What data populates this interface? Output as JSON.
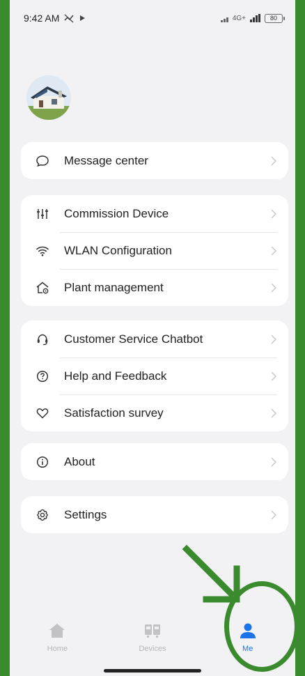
{
  "status_bar": {
    "time": "9:42 AM",
    "network": "4G+",
    "battery": "80"
  },
  "menu": {
    "group1": [
      {
        "label": "Message center",
        "icon": "message-icon"
      }
    ],
    "group2": [
      {
        "label": "Commission Device",
        "icon": "sliders-icon"
      },
      {
        "label": "WLAN Configuration",
        "icon": "wifi-icon"
      },
      {
        "label": "Plant management",
        "icon": "plant-house-icon"
      }
    ],
    "group3": [
      {
        "label": "Customer Service Chatbot",
        "icon": "headset-icon"
      },
      {
        "label": "Help and Feedback",
        "icon": "help-icon"
      },
      {
        "label": "Satisfaction survey",
        "icon": "heart-icon"
      }
    ],
    "group4": [
      {
        "label": "About",
        "icon": "info-icon"
      }
    ],
    "group5": [
      {
        "label": "Settings",
        "icon": "gear-icon"
      }
    ]
  },
  "tabbar": {
    "home": "Home",
    "devices": "Devices",
    "me": "Me"
  },
  "colors": {
    "accent": "#1a73e8",
    "annotation": "#3a8a2e"
  }
}
